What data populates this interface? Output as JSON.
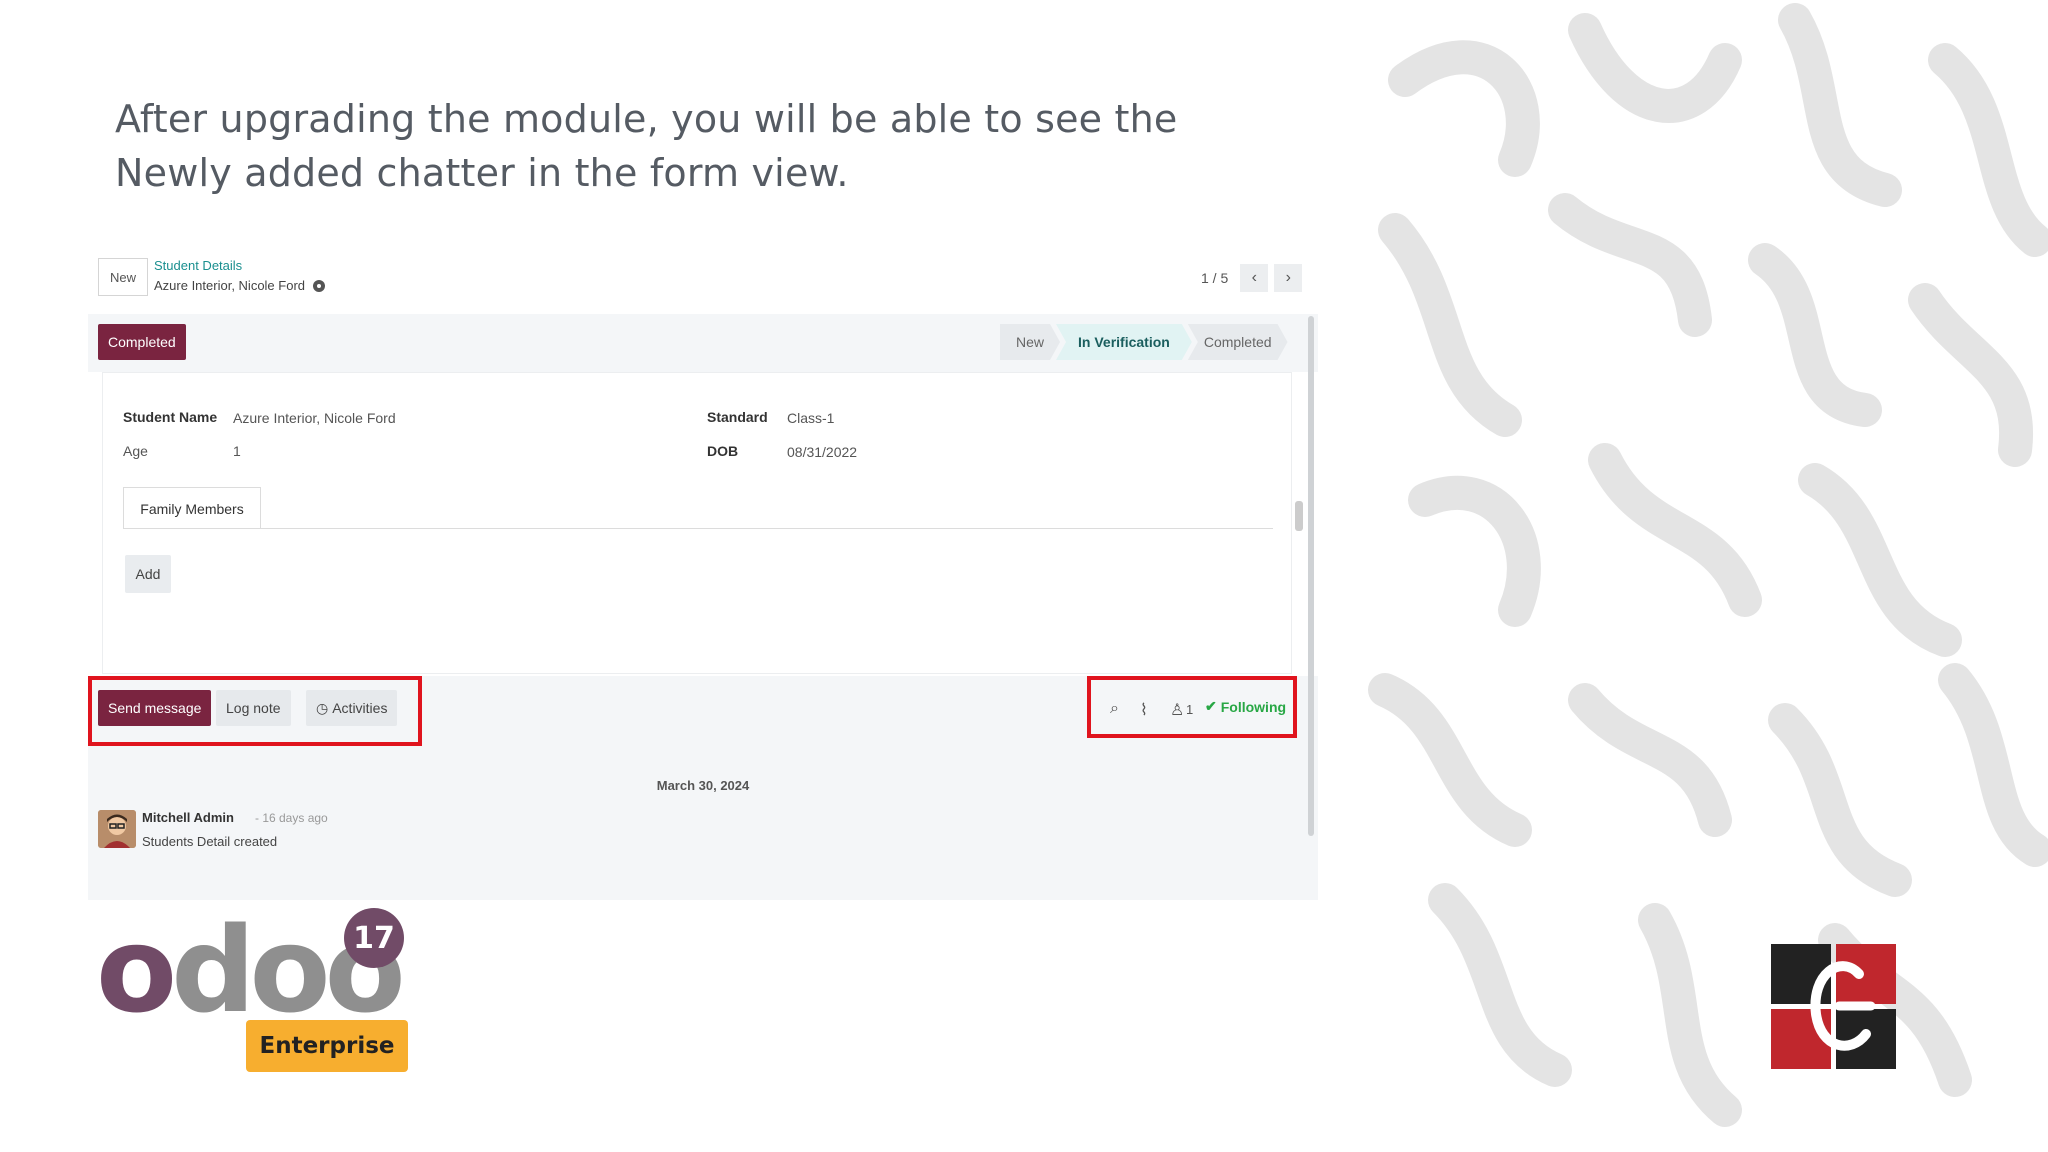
{
  "heading": {
    "line1": "After upgrading the module, you will be able to see the",
    "line2": "Newly added chatter in the form view."
  },
  "form": {
    "new_button": "New",
    "breadcrumb": "Student Details",
    "record_name": "Azure Interior, Nicole Ford",
    "pager": {
      "value": "1 / 5",
      "prev_icon": "chevron-left",
      "next_icon": "chevron-right"
    },
    "status_badge": "Completed",
    "stages": [
      "New",
      "In Verification",
      "Completed"
    ],
    "active_stage": "In Verification",
    "fields": {
      "student_name_label": "Student Name",
      "student_name_value": "Azure Interior, Nicole Ford",
      "age_label": "Age",
      "age_value": "1",
      "standard_label": "Standard",
      "standard_value": "Class-1",
      "dob_label": "DOB",
      "dob_value": "08/31/2022"
    },
    "tab_label": "Family Members",
    "add_button": "Add"
  },
  "chatter": {
    "send_message": "Send message",
    "log_note": "Log note",
    "activities": "Activities",
    "followers_count": "1",
    "following": "Following",
    "date_separator": "March 30, 2024",
    "message": {
      "author": "Mitchell Admin",
      "time": "- 16 days ago",
      "body": "Students Detail created"
    },
    "highlight_color": "#e0141e"
  },
  "branding": {
    "odoo_version": "17",
    "edition": "Enterprise",
    "accent": "#714b67",
    "edition_color": "#f7ae2f"
  }
}
